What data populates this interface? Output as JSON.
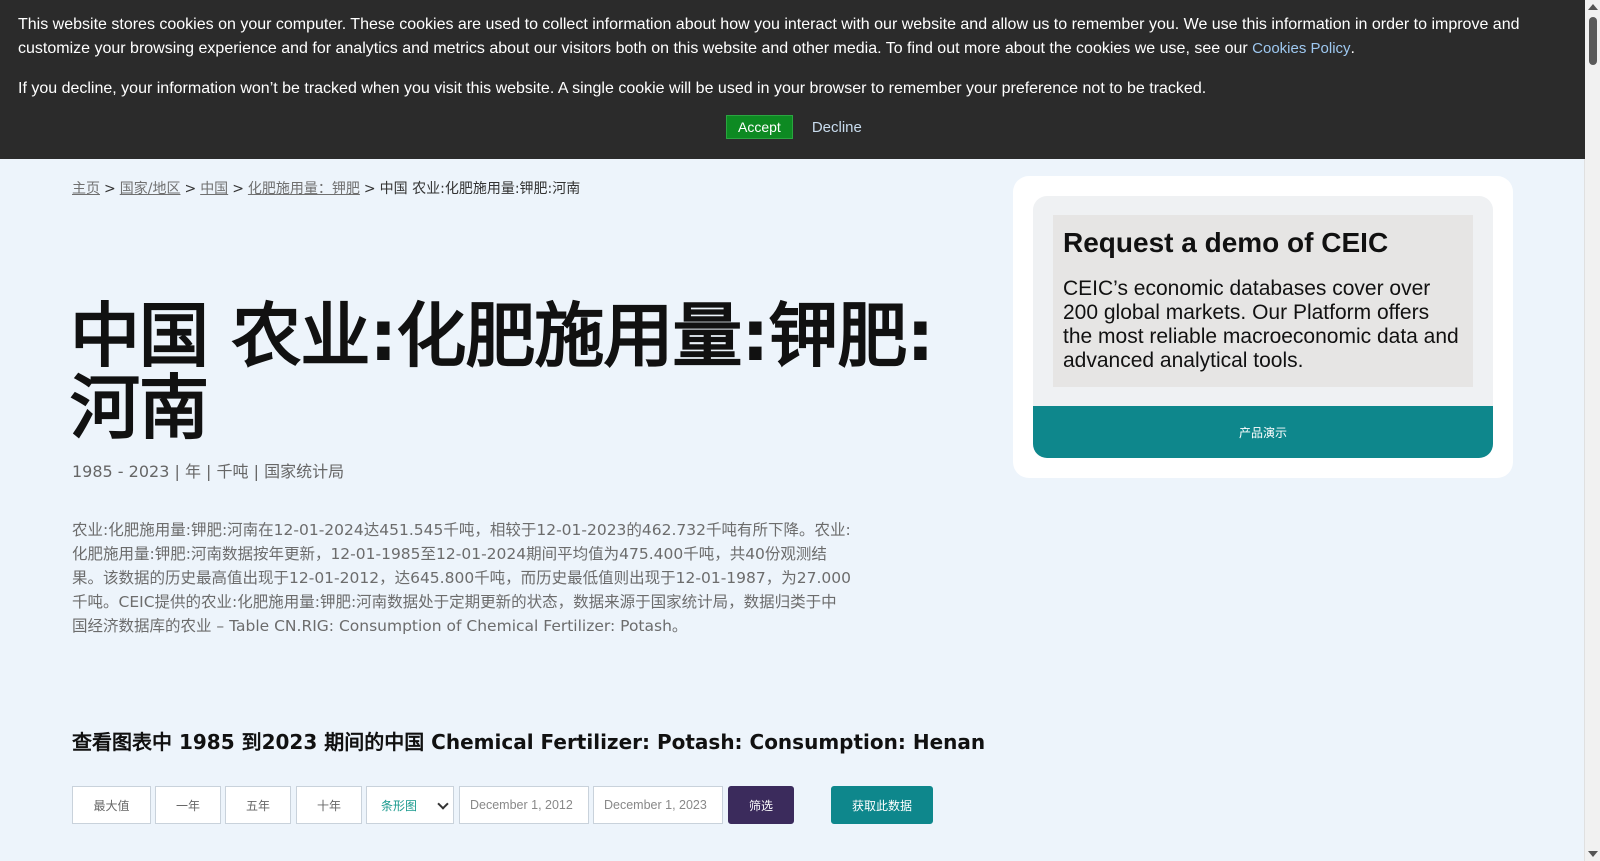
{
  "cookie_banner": {
    "text_1": "This website stores cookies on your computer. These cookies are used to collect information about how you interact with our website and allow us to remember you. We use this information in order to improve and customize your browsing experience and for analytics and metrics about our visitors both on this website and other media. To find out more about the cookies we use, see our ",
    "policy_link": "Cookies Policy",
    "text_1_end": ".",
    "text_2": "If you decline, your information won’t be tracked when you visit this website. A single cookie will be used in your browser to remember your preference not to be tracked.",
    "accept_label": "Accept",
    "decline_label": "Decline"
  },
  "breadcrumb": {
    "items": [
      "主页",
      "国家/地区",
      "中国",
      "化肥施用量：钾肥"
    ],
    "separator": ">",
    "current": "中国 农业:化肥施用量:钾肥:河南"
  },
  "page": {
    "title": "中国 农业:化肥施用量:钾肥:河南",
    "meta": "1985 - 2023 | 年 | 千吨 | 国家统计局",
    "description": "农业:化肥施用量:钾肥:河南在12-01-2024达451.545千吨，相较于12-01-2023的462.732千吨有所下降。农业:化肥施用量:钾肥:河南数据按年更新，12-01-1985至12-01-2024期间平均值为475.400千吨，共40份观测结果。该数据的历史最高值出现于12-01-2012，达645.800千吨，而历史最低值则出现于12-01-1987，为27.000千吨。CEIC提供的农业:化肥施用量:钾肥:河南数据处于定期更新的状态，数据来源于国家统计局，数据归类于中国经济数据库的农业 – Table CN.RIG: Consumption of Chemical Fertilizer: Potash。",
    "chart_heading": "查看图表中 1985 到2023 期间的中国 Chemical Fertilizer: Potash: Consumption: Henan"
  },
  "controls": {
    "max_label": "最大值",
    "one_year_label": "一年",
    "five_year_label": "五年",
    "ten_year_label": "十年",
    "chart_type_selected": "条形图",
    "date_from": "December 1, 2012",
    "date_to": "December 1, 2023",
    "filter_label": "筛选",
    "get_data_label": "获取此数据"
  },
  "demo_card": {
    "title": "Request a demo of CEIC",
    "body": "CEIC’s economic databases cover over 200 global markets. Our Platform offers the most reliable macroeconomic data and advanced analytical tools.",
    "button_label": "产品演示"
  },
  "colors": {
    "banner_bg": "#2b2b2b",
    "accept_green": "#0d8a22",
    "teal": "#0e878c",
    "filter_purple": "#3b2b5c",
    "page_bg": "#edf4fb"
  }
}
